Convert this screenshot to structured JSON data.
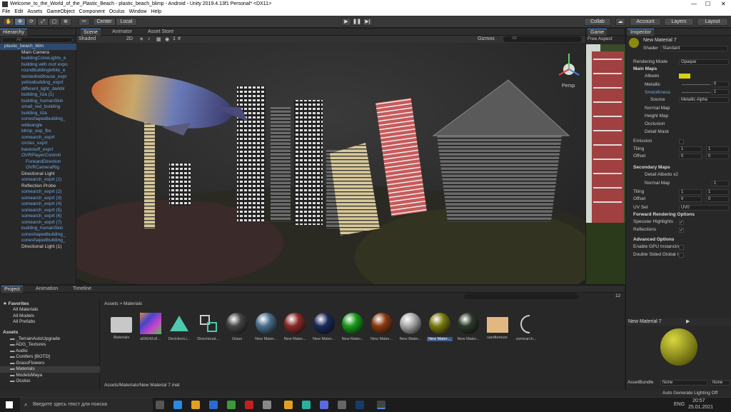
{
  "window": {
    "title": "Welcome_to_the_World_of_the_Plastic_Beach - plastic_beach_blimp - Android - Unity 2019.4.13f1 Personal* <DX11>"
  },
  "menu": [
    "File",
    "Edit",
    "Assets",
    "GameObject",
    "Component",
    "Oculus",
    "Window",
    "Help"
  ],
  "toolbar": {
    "center": "Center",
    "local": "Local",
    "collab": "Collab",
    "account": "Account",
    "layers": "Layers",
    "layout": "Layout"
  },
  "hierarchy": {
    "tab": "Hierarchy",
    "search_placeholder": "All",
    "root": "plastic_beach_blim",
    "items": [
      {
        "label": "Main Camera",
        "c": "white",
        "ind": 1
      },
      {
        "label": "buildingConeLights_e",
        "c": "blue",
        "ind": 1
      },
      {
        "label": "building with roof expo",
        "c": "blue",
        "ind": 1
      },
      {
        "label": "roundbuildingwhite_e",
        "c": "blue",
        "ind": 1
      },
      {
        "label": "twistedredhouse_expr",
        "c": "blue",
        "ind": 1
      },
      {
        "label": "yellowbuilding_exprt",
        "c": "blue",
        "ind": 1
      },
      {
        "label": "different_light_darkbl",
        "c": "blue",
        "ind": 1
      },
      {
        "label": "building_liza (1)",
        "c": "blue",
        "ind": 1
      },
      {
        "label": "building_humanSkin",
        "c": "blue",
        "ind": 1
      },
      {
        "label": "small_red_building",
        "c": "blue",
        "ind": 1
      },
      {
        "label": "building_liza",
        "c": "blue",
        "ind": 1
      },
      {
        "label": "coneshapedbuilding_",
        "c": "blue",
        "ind": 1
      },
      {
        "label": "wideangle",
        "c": "blue",
        "ind": 1
      },
      {
        "label": "blimp_exp_fbx",
        "c": "blue",
        "ind": 1
      },
      {
        "label": "somearch_exprt",
        "c": "blue",
        "ind": 1
      },
      {
        "label": "circles_exprt",
        "c": "blue",
        "ind": 1
      },
      {
        "label": "basestuff_exprt",
        "c": "blue",
        "ind": 1
      },
      {
        "label": "OVRPlayerControll",
        "c": "blue",
        "ind": 1
      },
      {
        "label": "ForwardDirection",
        "c": "blue",
        "ind": 2
      },
      {
        "label": "OVRCameraRig",
        "c": "blue",
        "ind": 2
      },
      {
        "label": "Directional Light",
        "c": "white",
        "ind": 1
      },
      {
        "label": "somearch_exprt (1)",
        "c": "blue",
        "ind": 1
      },
      {
        "label": "Reflection Probe",
        "c": "white",
        "ind": 1
      },
      {
        "label": "somearch_exprt (2)",
        "c": "blue",
        "ind": 1
      },
      {
        "label": "somearch_exprt (3)",
        "c": "blue",
        "ind": 1
      },
      {
        "label": "somearch_exprt (4)",
        "c": "blue",
        "ind": 1
      },
      {
        "label": "somearch_exprt (5)",
        "c": "blue",
        "ind": 1
      },
      {
        "label": "somearch_exprt (6)",
        "c": "blue",
        "ind": 1
      },
      {
        "label": "somearch_exprt (7)",
        "c": "blue",
        "ind": 1
      },
      {
        "label": "building_humanSkin",
        "c": "blue",
        "ind": 1
      },
      {
        "label": "coneshapedbuilding_",
        "c": "blue",
        "ind": 1
      },
      {
        "label": "coneshapedbuilding_",
        "c": "blue",
        "ind": 1
      },
      {
        "label": "Directional Light (1)",
        "c": "white",
        "ind": 1
      }
    ]
  },
  "scene": {
    "tabs": [
      "Scene",
      "Animator",
      "Asset Store"
    ],
    "shaded": "Shaded",
    "twod": "2D",
    "gizmos": "Gizmos",
    "search": "All",
    "persp": "Persp",
    "layers_count": "1"
  },
  "game": {
    "tab": "Game",
    "aspect": "Free Aspect"
  },
  "inspector": {
    "tab": "Inspector",
    "material_name": "New Material 7",
    "shader_label": "Shader",
    "shader_value": "Standard",
    "rendering_mode_label": "Rendering Mode",
    "rendering_mode_value": "Opaque",
    "main_maps": "Main Maps",
    "albedo": "Albedo",
    "metallic": "Metallic",
    "metallic_value": "0",
    "smoothness": "Smoothness",
    "smoothness_value": "1",
    "source": "Source",
    "source_value": "Metallic Alpha",
    "normal_map": "Normal Map",
    "height_map": "Height Map",
    "occlusion": "Occlusion",
    "detail_mask": "Detail Mask",
    "emission": "Emission",
    "tiling": "Tiling",
    "offset": "Offset",
    "tiling_x": "1",
    "tiling_y": "1",
    "offset_x": "0",
    "offset_y": "0",
    "secondary_maps": "Secondary Maps",
    "detail_albedo": "Detail Albedo x2",
    "normal_map2": "Normal Map",
    "normal_map2_value": "1",
    "tiling2_x": "1",
    "tiling2_y": "1",
    "offset2_x": "0",
    "offset2_y": "0",
    "uv_set": "UV Set",
    "uv_set_value": "UV0",
    "forward_opts": "Forward Rendering Options",
    "specular": "Specular Highlights",
    "reflections": "Reflections",
    "advanced": "Advanced Options",
    "gpu_instancing": "Enable GPU Instancin",
    "double_sided": "Double Sided Global I",
    "preview_name": "New Material 7",
    "assetbundle_label": "AssetBundle",
    "assetbundle_value": "None",
    "assetbundle_variant": "None"
  },
  "project": {
    "tabs": [
      "Project",
      "Animation",
      "Timeline"
    ],
    "favorites": "Favorites",
    "fav_items": [
      "All Materials",
      "All Models",
      "All Prefabs"
    ],
    "assets_root": "Assets",
    "folders": [
      "_TerrainAutoUpgrade",
      "ADG_Textures",
      "Audio",
      "Conifers [BOTD]",
      "GrassFlowers",
      "Materials",
      "ModelsMaya",
      "Oculus"
    ],
    "breadcrumb_root": "Assets",
    "breadcrumb_folder": "Materials",
    "asset_count": "12",
    "assets": [
      {
        "label": "Materials",
        "kind": "folder",
        "color": "#c8c8c8"
      },
      {
        "label": "a55642c8...",
        "kind": "tex",
        "color": "#c44"
      },
      {
        "label": "DerictionLi...",
        "kind": "tri",
        "color": "#4ec9b0"
      },
      {
        "label": "Directional...",
        "kind": "link",
        "color": "#4ec9b0"
      },
      {
        "label": "Glass",
        "kind": "ball",
        "color": "#444"
      },
      {
        "label": "New Mater...",
        "kind": "ball",
        "color": "#4a6e8a"
      },
      {
        "label": "New Mater...",
        "kind": "ball",
        "color": "#8a2a2a"
      },
      {
        "label": "New Mater...",
        "kind": "ball",
        "color": "#1a2a5a"
      },
      {
        "label": "New Mater...",
        "kind": "ball",
        "color": "#1a9a1a"
      },
      {
        "label": "New Mater...",
        "kind": "ball",
        "color": "#8a3a10"
      },
      {
        "label": "New Mater...",
        "kind": "ball",
        "color": "#aaa"
      },
      {
        "label": "New Mater...",
        "kind": "ball",
        "color": "#7a7a10"
      },
      {
        "label": "New Mater...",
        "kind": "ball",
        "color": "#2a3a2a"
      },
      {
        "label": "sandtexture",
        "kind": "flat",
        "color": "#e3b880"
      },
      {
        "label": "somearch...",
        "kind": "arc",
        "color": "#ccc"
      }
    ],
    "status_path": "Assets/Materials/New Material 7.mat",
    "auto_generate": "Auto Generate Lighting Off"
  },
  "taskbar": {
    "search": "Введите здесь текст для поиска",
    "lang": "ENG",
    "time": "20:57",
    "date": "25.01.2021"
  }
}
